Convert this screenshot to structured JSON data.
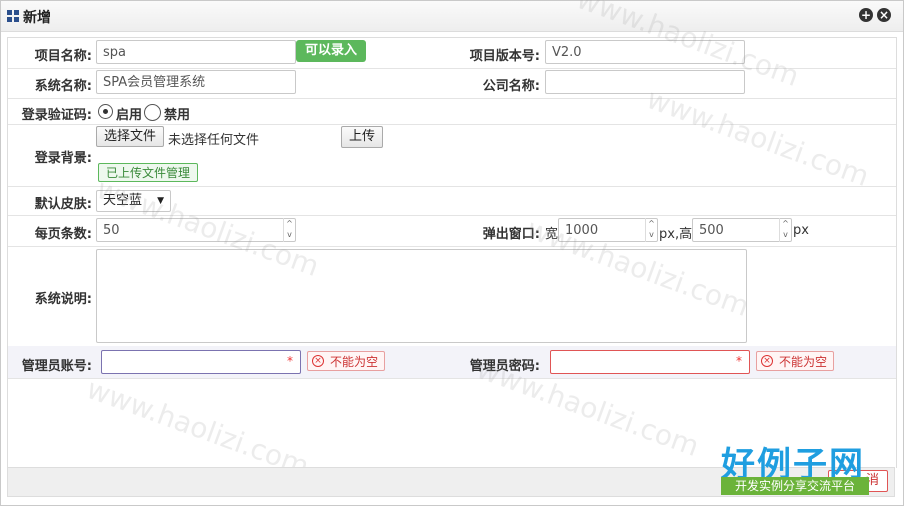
{
  "window": {
    "title": "新增"
  },
  "form": {
    "project_name": {
      "label": "项目名称:",
      "value": "spa",
      "badge": "可以录入"
    },
    "project_version": {
      "label": "项目版本号:",
      "value": "V2.0"
    },
    "system_name": {
      "label": "系统名称:",
      "value": "SPA会员管理系统"
    },
    "company_name": {
      "label": "公司名称:",
      "value": ""
    },
    "login_captcha": {
      "label": "登录验证码:",
      "options": [
        "启用",
        "禁用"
      ],
      "selected": "启用"
    },
    "login_bg": {
      "label": "登录背景:",
      "choose_btn": "选择文件",
      "no_file": "未选择任何文件",
      "upload_btn": "上传",
      "uploaded_btn": "已上传文件管理"
    },
    "default_skin": {
      "label": "默认皮肤:",
      "selected": "天空蓝"
    },
    "page_size": {
      "label": "每页条数:",
      "value": "50"
    },
    "popup": {
      "label": "弹出窗口:",
      "width_prefix": "宽",
      "width": "1000",
      "sep": "px,高",
      "height": "500",
      "suffix": "px"
    },
    "sys_desc": {
      "label": "系统说明:",
      "value": ""
    },
    "admin_account": {
      "label": "管理员账号:",
      "value": "",
      "required": "*",
      "error": "不能为空"
    },
    "admin_password": {
      "label": "管理员密码:",
      "value": "",
      "required": "*",
      "error": "不能为空"
    }
  },
  "footer": {
    "cancel_label": "消"
  },
  "watermark": {
    "text": "www.haolizi.com"
  },
  "brand": {
    "title": "好例子网",
    "subtitle": "开发实例分享交流平台"
  },
  "colors": {
    "accent": "#5cb85c",
    "error": "#cc3333",
    "brand_blue": "#1f9ee0"
  }
}
